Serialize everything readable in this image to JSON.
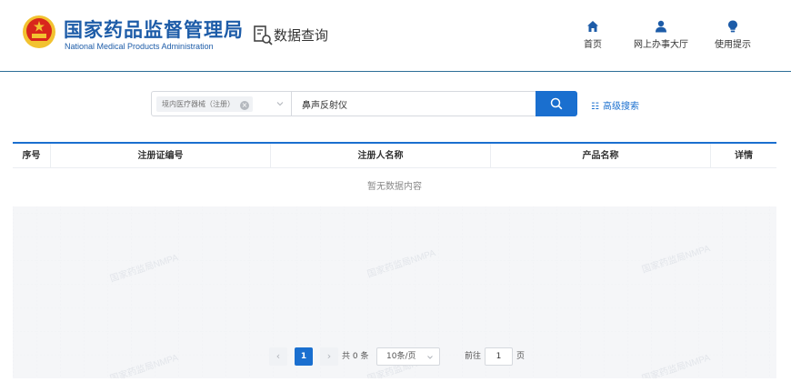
{
  "header": {
    "brand_cn": "国家药品监督管理局",
    "brand_en": "National Medical Products Administration",
    "section_title": "数据查询",
    "nav": [
      {
        "label": "首页",
        "icon": "home-icon"
      },
      {
        "label": "网上办事大厅",
        "icon": "user-icon"
      },
      {
        "label": "使用提示",
        "icon": "lightbulb-icon"
      }
    ]
  },
  "search": {
    "category_tag": "境内医疗器械（注册）",
    "keyword": "鼻声反射仪",
    "advanced_label": "高级搜索"
  },
  "table": {
    "columns": [
      "序号",
      "注册证编号",
      "注册人名称",
      "产品名称",
      "详情"
    ],
    "empty_text": "暂无数据内容"
  },
  "watermark_text": "国家药监局NMPA",
  "pagination": {
    "prev": "‹",
    "current_page": "1",
    "next": "›",
    "total_text": "共 0 条",
    "page_size": "10条/页",
    "goto_prefix": "前往",
    "goto_value": "1",
    "goto_suffix": "页"
  },
  "colors": {
    "accent": "#1a6fcf",
    "brand": "#1d5ca8",
    "emblem_red": "#d8261c",
    "emblem_gold": "#f2c230"
  }
}
